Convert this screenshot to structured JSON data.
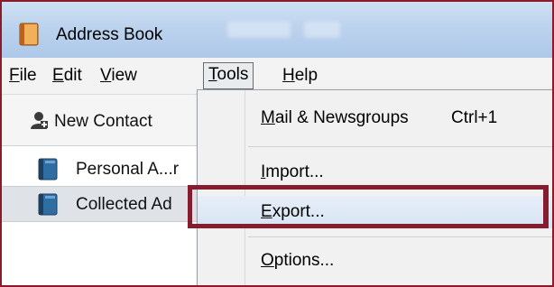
{
  "window": {
    "title": "Address Book",
    "frame_color": "#8b1a2b"
  },
  "menubar": {
    "file": "File",
    "edit": "Edit",
    "view": "View",
    "tools": "Tools",
    "help": "Help"
  },
  "toolbar": {
    "new_contact": "New Contact"
  },
  "directories": [
    {
      "label": "Personal A...r",
      "selected": false
    },
    {
      "label": "Collected Ad",
      "selected": true
    }
  ],
  "tools_menu": {
    "items": [
      {
        "label": "Mail & Newsgroups",
        "shortcut": "Ctrl+1"
      },
      {
        "label": "Import..."
      },
      {
        "label": "Export...",
        "highlighted": true
      },
      {
        "label": "Options..."
      }
    ]
  },
  "colors": {
    "highlight_box": "#861d2e",
    "titlebar": "#bcd3ee"
  }
}
